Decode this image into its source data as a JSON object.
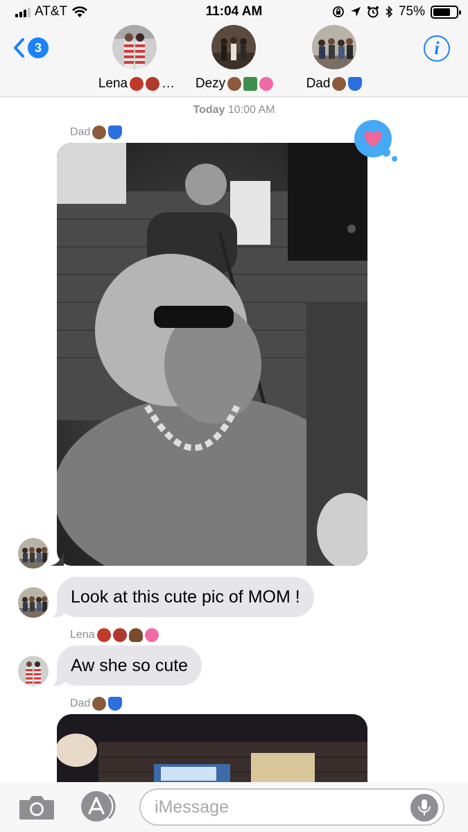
{
  "status_bar": {
    "carrier": "AT&T",
    "time": "11:04 AM",
    "battery_percent": "75%",
    "battery_level": 0.75,
    "icons": [
      "signal-icon",
      "wifi-icon",
      "rotation-lock-icon",
      "location-icon",
      "alarm-icon",
      "bluetooth-icon",
      "battery-icon"
    ]
  },
  "nav": {
    "back_count": "3",
    "participants": [
      {
        "name": "Lena",
        "suffix": "…"
      },
      {
        "name": "Dezy",
        "suffix": ""
      },
      {
        "name": "Dad",
        "suffix": ""
      }
    ],
    "info_glyph": "i"
  },
  "conversation": {
    "timestamp_day": "Today",
    "timestamp_time": "10:00 AM",
    "messages": [
      {
        "sender": "Dad",
        "type": "photo",
        "tapback": "heart"
      },
      {
        "type": "text",
        "text": "Look at this cute pic of MOM !"
      },
      {
        "sender": "Lena",
        "type": "text",
        "text": "Aw she so cute"
      },
      {
        "sender": "Dad",
        "type": "photo"
      }
    ]
  },
  "input": {
    "placeholder": "iMessage"
  },
  "colors": {
    "accent": "#1a82fb",
    "bubble_gray": "#e5e5ea",
    "tapback_blue": "#45a9f5",
    "heart_pink": "#f2679a",
    "meta_gray": "#8e8e93"
  }
}
